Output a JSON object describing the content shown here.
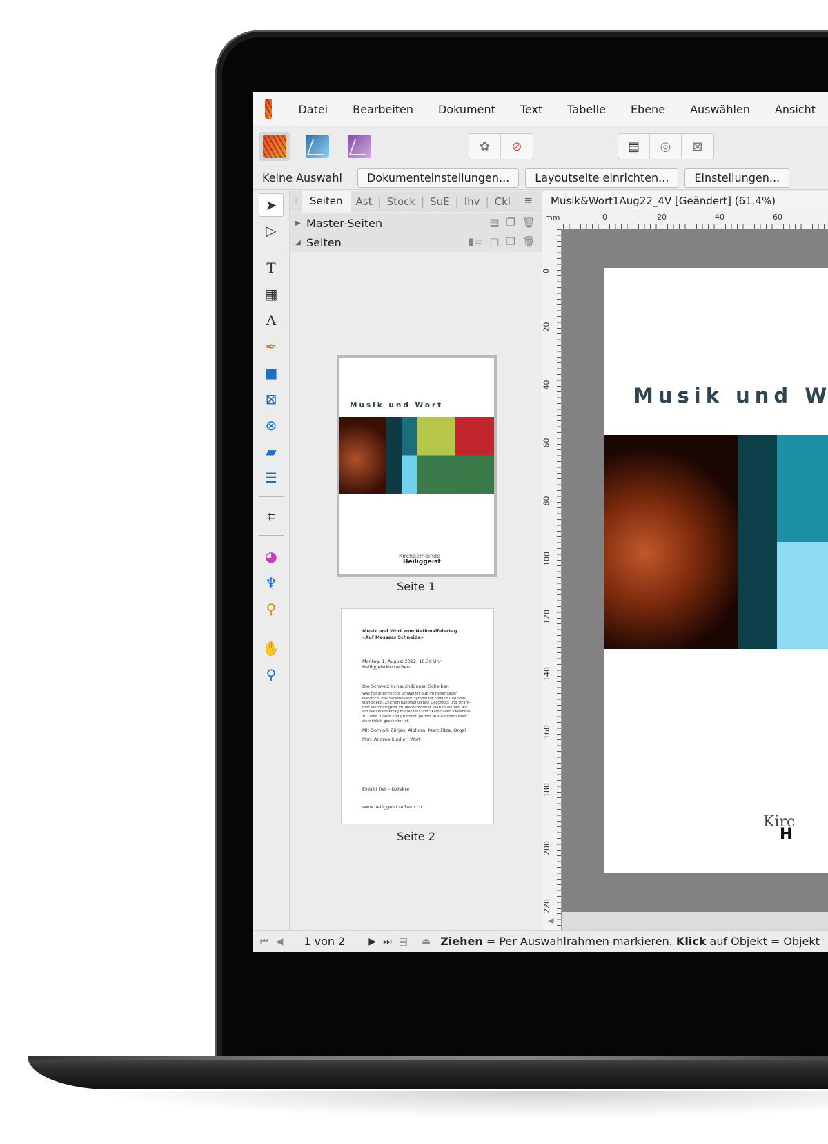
{
  "menu": [
    "Datei",
    "Bearbeiten",
    "Dokument",
    "Text",
    "Tabelle",
    "Ebene",
    "Auswählen",
    "Ansicht"
  ],
  "context": {
    "status_label": "Keine Auswahl",
    "buttons": [
      "Dokumenteinstellungen...",
      "Layoutseite einrichten...",
      "Einstellungen..."
    ]
  },
  "panel": {
    "tabs": [
      "Seiten",
      "Ast",
      "Stock",
      "SuE",
      "Ihv",
      "Ckl"
    ],
    "master_label": "Master-Seiten",
    "pages_label": "Seiten",
    "page1_label": "Seite 1",
    "page2_label": "Seite 2"
  },
  "thumb1": {
    "title": "Musik und Wort",
    "logo_line1": "Kirchgemeinde",
    "logo_line2": "Heiliggeist"
  },
  "thumb2": {
    "lines": [
      "Musik und Wort zum Nationalfeiertag",
      "«Auf Messers Schneide»",
      "Montag, 1. August 2022, 10.30 Uhr",
      "Heiliggeistkirche Bern",
      "Die Schweiz in hauchdünnen Scheiben",
      "Was hat jeder rechte Schweizer Bub im Hosensack?\nNatürlich, das Sackmesser! Symbol für Freiheit und Selb-\nständigkeit, Zeichen handwerklichen Geschicks und stram-\nmer Wehrhaftigkeit im Taschenformat. Darum werden wir\nam Nationalfeiertag mit Messer und Skalpell der Swissness\nzu Leibe rücken und gründlich prüfen, aus welchem Holz\nsie wirklich geschnitzt ist.",
      "Mit Dominik Zürjen, Alphorn, Marc Fitze, Orgel",
      "Pfrn. Andrea Kindler, Wort",
      "Eintritt frei – Kollekte",
      "www.heiliggeist.refbern.ch"
    ]
  },
  "document": {
    "title": "Musik&Wort1Aug22_4V [Geändert] (61.4%)",
    "ruler_unit": "mm",
    "h_ruler": [
      "0",
      "20",
      "40",
      "60"
    ],
    "v_ruler": [
      "0",
      "20",
      "40",
      "60",
      "80",
      "100",
      "120",
      "140",
      "160",
      "180",
      "200",
      "220"
    ],
    "page_title": "Musik und W",
    "logo_line1": "Kirc",
    "logo_line2": "H"
  },
  "status": {
    "page_counter": "1 von 2",
    "hint_bold1": "Ziehen",
    "hint_text1": " = Per Auswahlrahmen markieren. ",
    "hint_bold2": "Klick",
    "hint_text2": " auf Objekt = Objekt"
  },
  "colors": {
    "title_text": "#2f4550",
    "accent_cyan": "#3ec6e6",
    "persona_publisher": "#e5482a"
  }
}
